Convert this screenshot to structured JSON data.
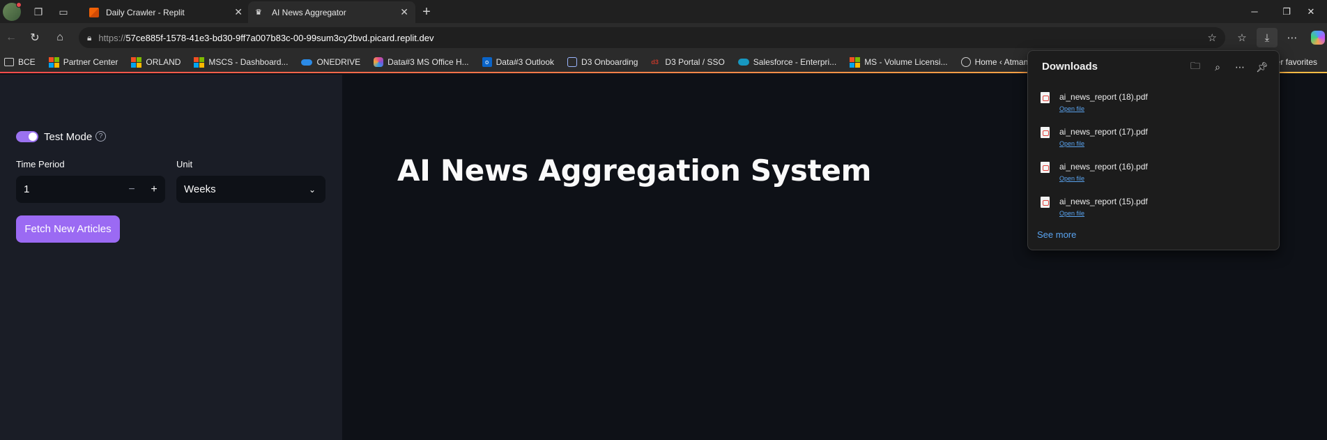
{
  "browser": {
    "tabs": [
      {
        "title": "Daily Crawler - Replit",
        "active": false
      },
      {
        "title": "AI News Aggregator",
        "active": true
      }
    ],
    "url": {
      "scheme": "https://",
      "host": "57ce885f-1578-41e3-bd30-9ff7a007b83c-00-99sum3cy2bvd.picard.replit.dev"
    },
    "favorites": [
      {
        "label": "BCE",
        "icon": "folder-icon"
      },
      {
        "label": "Partner Center",
        "icon": "microsoft-icon"
      },
      {
        "label": "ORLAND",
        "icon": "microsoft-icon"
      },
      {
        "label": "MSCS - Dashboard...",
        "icon": "microsoft-icon"
      },
      {
        "label": "ONEDRIVE",
        "icon": "onedrive-icon"
      },
      {
        "label": "Data#3 MS Office H...",
        "icon": "office-icon"
      },
      {
        "label": "Data#3 Outlook",
        "icon": "outlook-icon"
      },
      {
        "label": "D3 Onboarding",
        "icon": "lock-badge-icon"
      },
      {
        "label": "D3 Portal / SSO",
        "icon": "d3-icon"
      },
      {
        "label": "Salesforce - Enterpri...",
        "icon": "salesforce-icon"
      },
      {
        "label": "MS - Volume Licensi...",
        "icon": "microsoft-icon"
      },
      {
        "label": "Home ‹ Atman Aca...",
        "icon": "globe-icon"
      }
    ],
    "other_favorites": "her favorites"
  },
  "downloads": {
    "title": "Downloads",
    "items": [
      {
        "name": "ai_news_report (18).pdf",
        "action": "Open file"
      },
      {
        "name": "ai_news_report (17).pdf",
        "action": "Open file"
      },
      {
        "name": "ai_news_report (16).pdf",
        "action": "Open file"
      },
      {
        "name": "ai_news_report (15).pdf",
        "action": "Open file"
      }
    ],
    "see_more": "See more"
  },
  "sidebar": {
    "test_mode_label": "Test Mode",
    "test_mode_on": true,
    "time_period_label": "Time Period",
    "time_period_value": "1",
    "unit_label": "Unit",
    "unit_value": "Weeks",
    "fetch_button": "Fetch New Articles"
  },
  "main": {
    "title": "AI News Aggregation System"
  },
  "colors": {
    "accent": "#9b6af3",
    "link": "#5aa4f0",
    "background": "#0e1117"
  }
}
